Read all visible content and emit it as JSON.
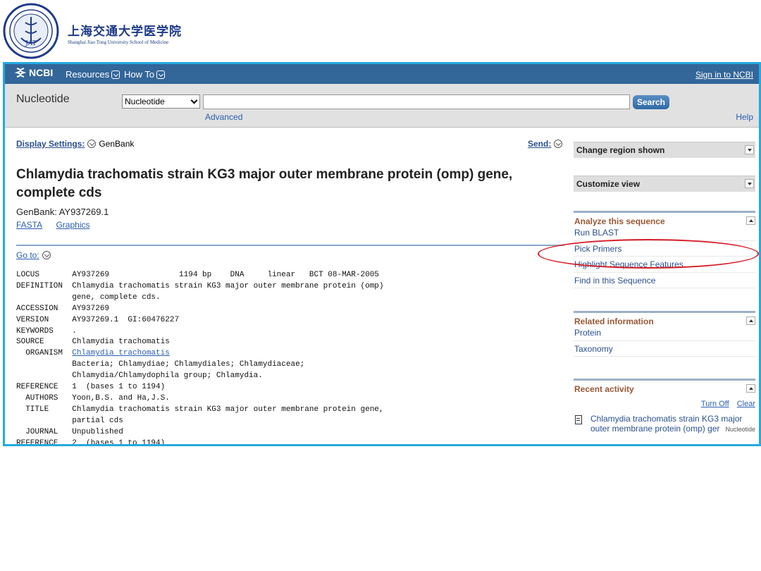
{
  "slide": {
    "logo_cn": "上海交通大学医学院",
    "logo_en": "Shanghai Jiao Tong University School of Medicine",
    "seal_text": "JAT"
  },
  "ncbi": {
    "brand": "NCBI",
    "nav": [
      "Resources",
      "How To"
    ],
    "sign_in": "Sign in to NCBI"
  },
  "search": {
    "db_title": "Nucleotide",
    "db_selected": "Nucleotide",
    "query": "",
    "button": "Search",
    "advanced": "Advanced",
    "help": "Help"
  },
  "record": {
    "display_settings": "Display Settings:",
    "display_format": "GenBank",
    "send": "Send:",
    "title": "Chlamydia trachomatis strain KG3 major outer membrane protein (omp) gene, complete cds",
    "genbank_id": "GenBank: AY937269.1",
    "links": [
      "FASTA",
      "Graphics"
    ],
    "goto": "Go to:",
    "flatfile": [
      {
        "k": "LOCUS",
        "v": "AY937269               1194 bp    DNA     linear   BCT 08-MAR-2005"
      },
      {
        "k": "DEFINITION",
        "v": "Chlamydia trachomatis strain KG3 major outer membrane protein (omp)"
      },
      {
        "k": "",
        "v": "gene, complete cds."
      },
      {
        "k": "ACCESSION",
        "v": "AY937269"
      },
      {
        "k": "VERSION",
        "v": "AY937269.1  GI:60476227"
      },
      {
        "k": "KEYWORDS",
        "v": "."
      },
      {
        "k": "SOURCE",
        "v": "Chlamydia trachomatis"
      },
      {
        "k": "  ORGANISM",
        "v": "Chlamydia trachomatis",
        "link": true
      },
      {
        "k": "",
        "v": "Bacteria; Chlamydiae; Chlamydiales; Chlamydiaceae;"
      },
      {
        "k": "",
        "v": "Chlamydia/Chlamydophila group; Chlamydia."
      },
      {
        "k": "REFERENCE",
        "v": "1  (bases 1 to 1194)"
      },
      {
        "k": "  AUTHORS",
        "v": "Yoon,B.S. and Ha,J.S."
      },
      {
        "k": "  TITLE",
        "v": "Chlamydia trachomatis strain KG3 major outer membrane protein gene,"
      },
      {
        "k": "",
        "v": "partial cds"
      },
      {
        "k": "  JOURNAL",
        "v": "Unpublished"
      },
      {
        "k": "REFERENCE",
        "v": "2  (bases 1 to 1194)"
      }
    ]
  },
  "sidebar": {
    "change_region": "Change region shown",
    "customize_view": "Customize view",
    "analyze": {
      "title": "Analyze this sequence",
      "items": [
        "Run BLAST",
        "Pick Primers",
        "Highlight Sequence Features",
        "Find in this Sequence"
      ]
    },
    "related": {
      "title": "Related information",
      "items": [
        "Protein",
        "Taxonomy"
      ]
    },
    "recent": {
      "title": "Recent activity",
      "turn_off": "Turn Off",
      "clear": "Clear",
      "item_text": "Chlamydia trachomatis strain KG3 major outer membrane protein (omp) ger",
      "item_db": "Nucleotide"
    }
  },
  "colors": {
    "frame": "#26a9e0",
    "ncbi_bar": "#336699",
    "annotation": "#d61f2a",
    "section_title": "#985735"
  }
}
